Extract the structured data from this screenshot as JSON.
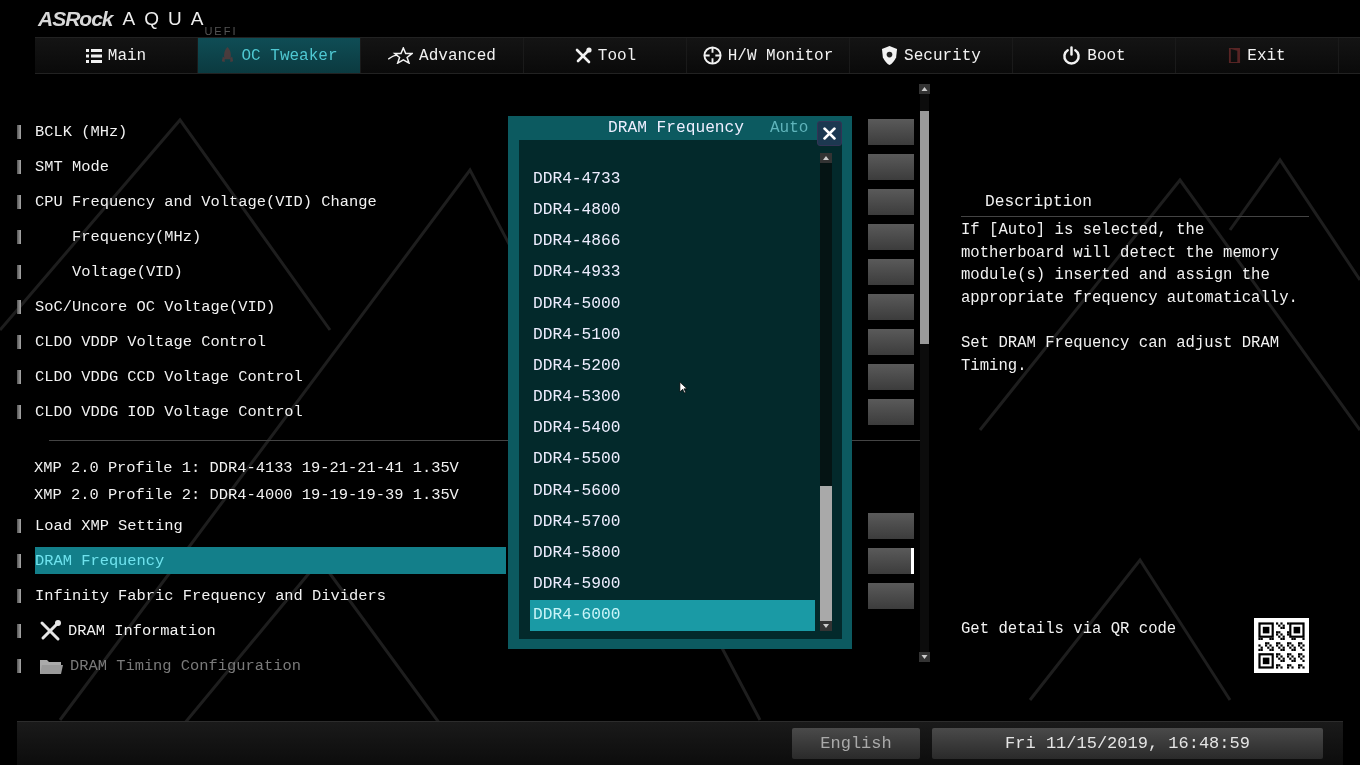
{
  "brand": {
    "name": "ASRock",
    "product": "AQUA",
    "suffix": "UEFI"
  },
  "tabs": [
    {
      "label": "Main",
      "selected": false
    },
    {
      "label": "OC Tweaker",
      "selected": true
    },
    {
      "label": "Advanced",
      "selected": false
    },
    {
      "label": "Tool",
      "selected": false
    },
    {
      "label": "H/W Monitor",
      "selected": false
    },
    {
      "label": "Security",
      "selected": false
    },
    {
      "label": "Boot",
      "selected": false
    },
    {
      "label": "Exit",
      "selected": false
    }
  ],
  "settings": [
    {
      "kind": "setting",
      "label": "BCLK (MHz)",
      "selected": false,
      "disabled": false
    },
    {
      "kind": "setting",
      "label": "SMT Mode",
      "selected": false,
      "disabled": false
    },
    {
      "kind": "setting",
      "label": "CPU Frequency and Voltage(VID) Change",
      "selected": false,
      "disabled": false,
      "children": [
        {
          "kind": "setting",
          "label": "Frequency(MHz)",
          "selected": false,
          "disabled": false
        },
        {
          "kind": "setting",
          "label": "Voltage(VID)",
          "selected": false,
          "disabled": false
        }
      ]
    },
    {
      "kind": "setting",
      "label": "SoC/Uncore OC Voltage(VID)",
      "selected": false,
      "disabled": false
    },
    {
      "kind": "setting",
      "label": "CLDO VDDP Voltage Control",
      "selected": false,
      "disabled": false
    },
    {
      "kind": "setting",
      "label": "CLDO VDDG CCD Voltage Control",
      "selected": false,
      "disabled": false
    },
    {
      "kind": "setting",
      "label": "CLDO VDDG IOD Voltage Control",
      "selected": false,
      "disabled": false
    },
    {
      "kind": "divider"
    },
    {
      "kind": "info",
      "label": "XMP 2.0 Profile 1: DDR4-4133 19-21-21-41 1.35V"
    },
    {
      "kind": "info",
      "label": "XMP 2.0 Profile 2: DDR4-4000 19-19-19-39 1.35V"
    },
    {
      "kind": "setting",
      "label": "Load XMP Setting",
      "selected": false,
      "disabled": false
    },
    {
      "kind": "setting",
      "label": "DRAM Frequency",
      "selected": true,
      "disabled": false
    },
    {
      "kind": "submenu",
      "label": "Infinity Fabric Frequency and Dividers",
      "selected": false,
      "disabled": false
    },
    {
      "kind": "tool-link",
      "label": "DRAM Information",
      "selected": false,
      "disabled": false
    },
    {
      "kind": "folder-link",
      "label": "DRAM Timing Configuration",
      "selected": false,
      "disabled": true
    }
  ],
  "popup": {
    "title": "DRAM Frequency",
    "behind_value": "Auto",
    "options": [
      {
        "label": "DDR4-4733",
        "selected": false
      },
      {
        "label": "DDR4-4800",
        "selected": false
      },
      {
        "label": "DDR4-4866",
        "selected": false
      },
      {
        "label": "DDR4-4933",
        "selected": false
      },
      {
        "label": "DDR4-5000",
        "selected": false
      },
      {
        "label": "DDR4-5100",
        "selected": false
      },
      {
        "label": "DDR4-5200",
        "selected": false
      },
      {
        "label": "DDR4-5300",
        "selected": false
      },
      {
        "label": "DDR4-5400",
        "selected": false
      },
      {
        "label": "DDR4-5500",
        "selected": false
      },
      {
        "label": "DDR4-5600",
        "selected": false
      },
      {
        "label": "DDR4-5700",
        "selected": false
      },
      {
        "label": "DDR4-5800",
        "selected": false
      },
      {
        "label": "DDR4-5900",
        "selected": false
      },
      {
        "label": "DDR4-6000",
        "selected": true
      }
    ]
  },
  "description": {
    "title": "Description",
    "paragraphs": [
      "If [Auto] is selected, the motherboard will detect the memory module(s) inserted and assign the appropriate frequency automatically.",
      "Set DRAM Frequency can adjust DRAM Timing."
    ],
    "qr_label": "Get details via QR code"
  },
  "status_bar": {
    "language": "English",
    "datetime": "Fri 11/15/2019, 16:48:59"
  }
}
